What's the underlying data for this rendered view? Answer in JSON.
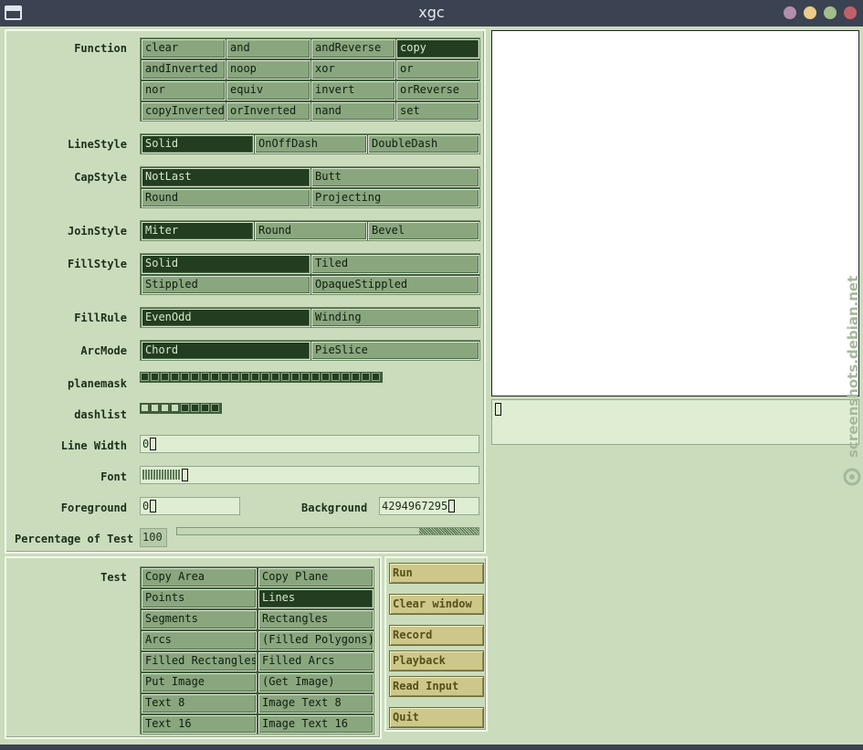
{
  "window": {
    "title": "xgc"
  },
  "colors": {
    "titlebar": "#3b4252",
    "btn_minimize": "#b48ead",
    "btn_maximize": "#ebcb8b",
    "btn_restore": "#a3be8c",
    "btn_close": "#bf616a"
  },
  "labels": {
    "function": "Function",
    "linestyle": "LineStyle",
    "capstyle": "CapStyle",
    "joinstyle": "JoinStyle",
    "fillstyle": "FillStyle",
    "fillrule": "FillRule",
    "arcmode": "ArcMode",
    "planemask": "planemask",
    "dashlist": "dashlist",
    "linewidth": "Line Width",
    "font": "Font",
    "foreground": "Foreground",
    "background": "Background",
    "percentage": "Percentage of Test",
    "test": "Test"
  },
  "function": {
    "options": [
      "clear",
      "and",
      "andReverse",
      "copy",
      "andInverted",
      "noop",
      "xor",
      "or",
      "nor",
      "equiv",
      "invert",
      "orReverse",
      "copyInverted",
      "orInverted",
      "nand",
      "set"
    ],
    "selected": "copy"
  },
  "linestyle": {
    "options": [
      "Solid",
      "OnOffDash",
      "DoubleDash"
    ],
    "selected": "Solid"
  },
  "capstyle": {
    "options": [
      "NotLast",
      "Butt",
      "Round",
      "Projecting"
    ],
    "selected": "NotLast"
  },
  "joinstyle": {
    "options": [
      "Miter",
      "Round",
      "Bevel"
    ],
    "selected": "Miter"
  },
  "fillstyle": {
    "options": [
      "Solid",
      "Tiled",
      "Stippled",
      "OpaqueStippled"
    ],
    "selected": "Solid"
  },
  "fillrule": {
    "options": [
      "EvenOdd",
      "Winding"
    ],
    "selected": "EvenOdd"
  },
  "arcmode": {
    "options": [
      "Chord",
      "PieSlice"
    ],
    "selected": "Chord"
  },
  "planemask": {
    "bits": [
      1,
      1,
      1,
      1,
      1,
      1,
      1,
      1,
      1,
      1,
      1,
      1,
      1,
      1,
      1,
      1,
      1,
      1,
      1,
      1,
      1,
      1,
      1,
      1,
      1,
      1,
      1,
      1,
      1,
      1,
      1,
      1
    ]
  },
  "dashlist": {
    "bits": [
      0,
      0,
      0,
      0,
      1,
      1,
      1,
      1
    ]
  },
  "fields": {
    "line_width": "0",
    "foreground": "0",
    "background": "4294967295",
    "percentage": "100"
  },
  "percentage_slider": {
    "value": 1.0
  },
  "test": {
    "options": [
      "Copy Area",
      "Copy Plane",
      "Points",
      "Lines",
      "Segments",
      "Rectangles",
      "Arcs",
      "(Filled Polygons)",
      "Filled Rectangles",
      "Filled Arcs",
      "Put Image",
      "(Get Image)",
      "Text 8",
      "Image Text 8",
      "Text 16",
      "Image Text 16"
    ],
    "selected": "Lines"
  },
  "actions": [
    "Run",
    "Clear window",
    "Record",
    "Playback",
    "Read Input",
    "Quit"
  ],
  "watermark": {
    "text": "screenshots.debian.net"
  }
}
